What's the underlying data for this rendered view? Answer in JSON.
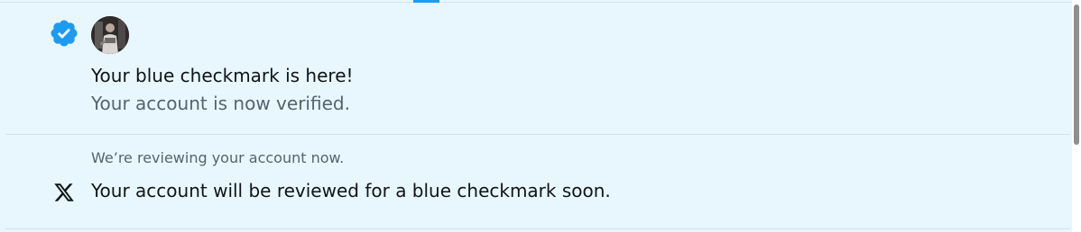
{
  "notifications": [
    {
      "icon": "verified-badge-icon",
      "title": "Your blue checkmark is here!",
      "subtitle": "Your account is now verified."
    },
    {
      "icon": "x-logo-icon",
      "notice": "We’re reviewing your account now.",
      "message": "Your account will be reviewed for a blue checkmark soon."
    }
  ],
  "colors": {
    "background": "#e8f7fd",
    "accent": "#1d9bf0",
    "primary_text": "#0f1419",
    "secondary_text": "#536471"
  }
}
